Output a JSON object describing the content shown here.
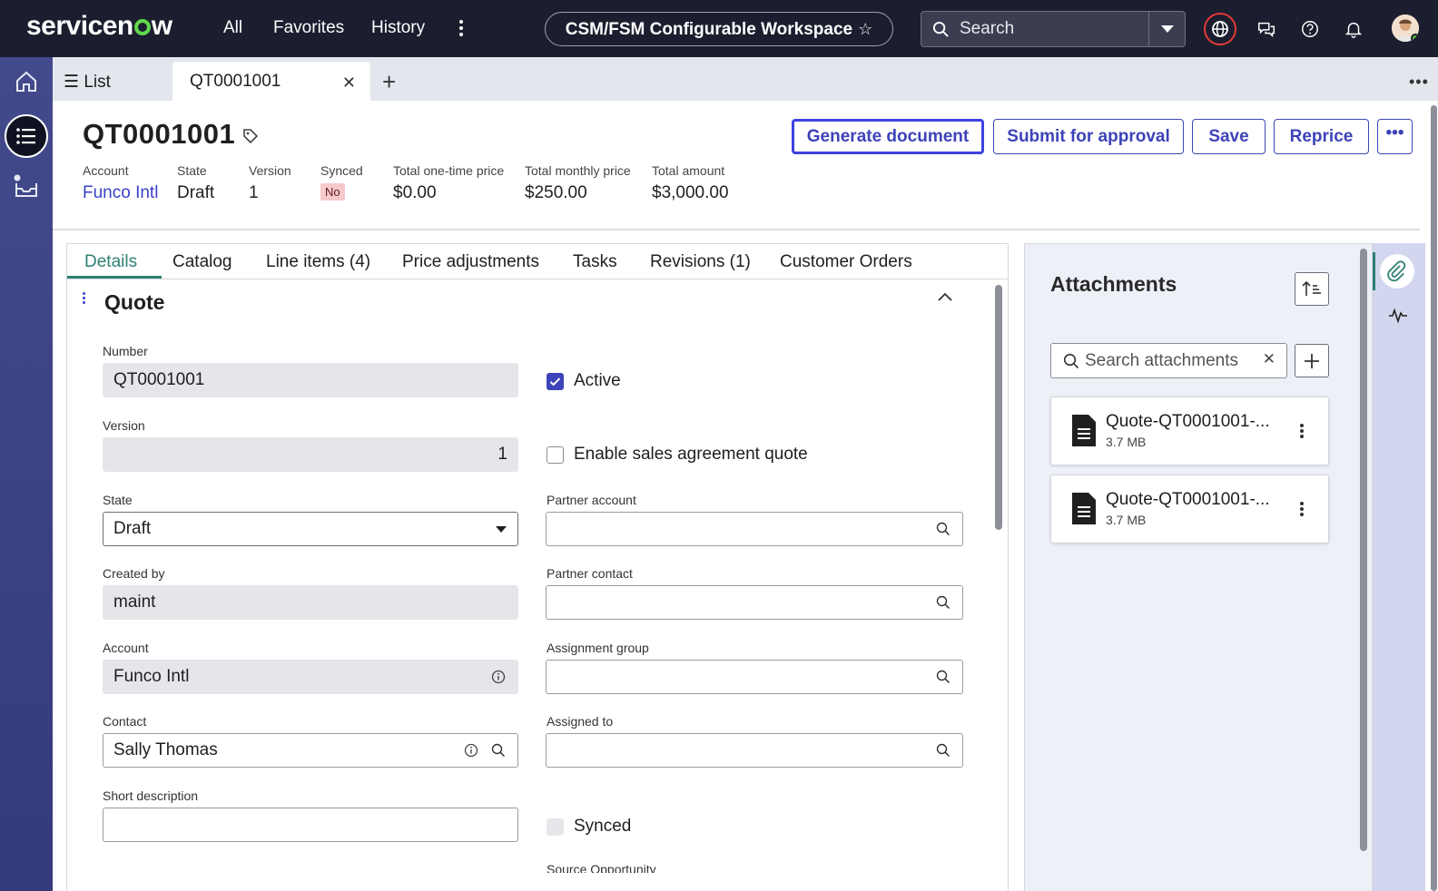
{
  "topbar": {
    "logo": "servicenow",
    "nav": [
      "All",
      "Favorites",
      "History"
    ],
    "workspace_title": "CSM/FSM Configurable Workspace",
    "search_placeholder": "Search"
  },
  "tabs": {
    "list_label": "List",
    "active_tab": "QT0001001"
  },
  "record": {
    "title": "QT0001001",
    "actions": {
      "generate": "Generate document",
      "submit": "Submit for approval",
      "save": "Save",
      "reprice": "Reprice"
    },
    "meta": [
      {
        "label": "Account",
        "value": "Funco Intl"
      },
      {
        "label": "State",
        "value": "Draft"
      },
      {
        "label": "Version",
        "value": "1"
      },
      {
        "label": "Synced",
        "value": "No"
      },
      {
        "label": "Total one-time price",
        "value": "$0.00"
      },
      {
        "label": "Total monthly price",
        "value": "$250.00"
      },
      {
        "label": "Total amount",
        "value": "$3,000.00"
      }
    ]
  },
  "form_tabs": [
    "Details",
    "Catalog",
    "Line items (4)",
    "Price adjustments",
    "Tasks",
    "Revisions (1)",
    "Customer Orders"
  ],
  "section": {
    "title": "Quote",
    "fields": {
      "number": {
        "label": "Number",
        "value": "QT0001001"
      },
      "version": {
        "label": "Version",
        "value": "1"
      },
      "state": {
        "label": "State",
        "value": "Draft"
      },
      "created_by": {
        "label": "Created by",
        "value": "maint"
      },
      "account": {
        "label": "Account",
        "value": "Funco Intl"
      },
      "contact": {
        "label": "Contact",
        "value": "Sally Thomas"
      },
      "short_description": {
        "label": "Short description",
        "value": ""
      },
      "active": {
        "label": "Active",
        "checked": true
      },
      "enable_sales": {
        "label": "Enable sales agreement quote",
        "checked": false
      },
      "partner_account": {
        "label": "Partner account",
        "value": ""
      },
      "partner_contact": {
        "label": "Partner contact",
        "value": ""
      },
      "assignment_group": {
        "label": "Assignment group",
        "value": ""
      },
      "assigned_to": {
        "label": "Assigned to",
        "value": ""
      },
      "synced": {
        "label": "Synced",
        "checked": false
      },
      "source_opportunity": {
        "label": "Source Opportunity"
      }
    }
  },
  "attachments": {
    "title": "Attachments",
    "search_placeholder": "Search attachments",
    "items": [
      {
        "name": "Quote-QT0001001-...",
        "size": "3.7 MB"
      },
      {
        "name": "Quote-QT0001001-...",
        "size": "3.7 MB"
      }
    ]
  },
  "colors": {
    "topbar": "#1b1e2e",
    "accent": "#3d43b8",
    "tab_active": "#2f8074",
    "badge_no_bg": "#f6c9cc",
    "siderail": "#3b4184",
    "logo_o": "#62d84e"
  },
  "icons": [
    "home-icon",
    "list-icon",
    "inbox-icon",
    "globe-icon",
    "chat-icon",
    "help-icon",
    "bell-icon",
    "search-icon",
    "tag-icon",
    "info-icon",
    "paperclip-icon",
    "activity-icon",
    "document-icon",
    "sort-icon"
  ]
}
